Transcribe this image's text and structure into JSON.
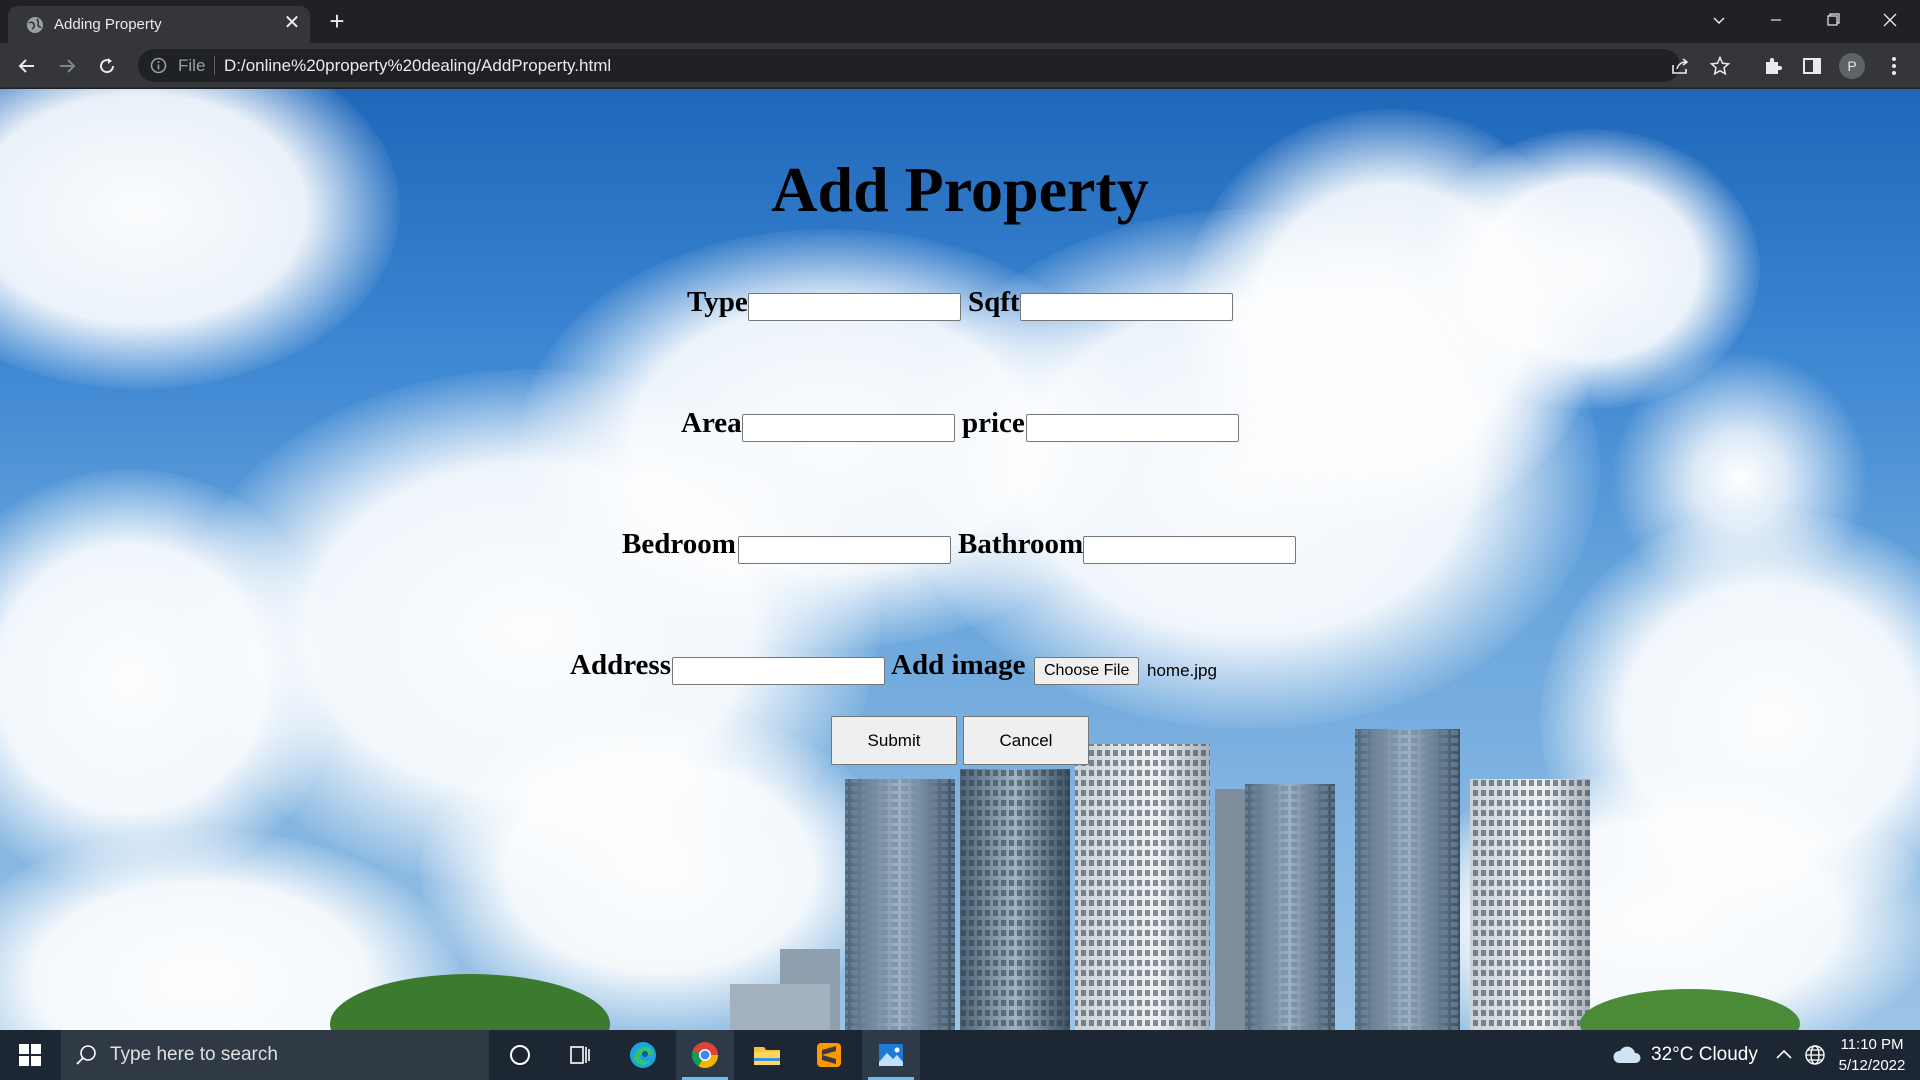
{
  "browser": {
    "tab_title": "Adding Property",
    "url_scheme": "File",
    "url": "D:/online%20property%20dealing/AddProperty.html",
    "profile_initial": "P"
  },
  "page": {
    "title": "Add Property",
    "fields": {
      "type_label": "Type",
      "sqft_label": "Sqft",
      "area_label": "Area",
      "price_label": "price",
      "bedroom_label": "Bedroom",
      "bathroom_label": "Bathroom",
      "address_label": "Address",
      "image_label": "Add image"
    },
    "values": {
      "type": "",
      "sqft": "",
      "area": "",
      "price": "",
      "bedroom": "",
      "bathroom": "",
      "address": ""
    },
    "file_button": "Choose File",
    "file_name": "home.jpg",
    "submit_label": "Submit",
    "cancel_label": "Cancel"
  },
  "taskbar": {
    "search_placeholder": "Type here to search",
    "weather": "32°C  Cloudy",
    "time": "11:10 PM",
    "date": "5/12/2022"
  }
}
